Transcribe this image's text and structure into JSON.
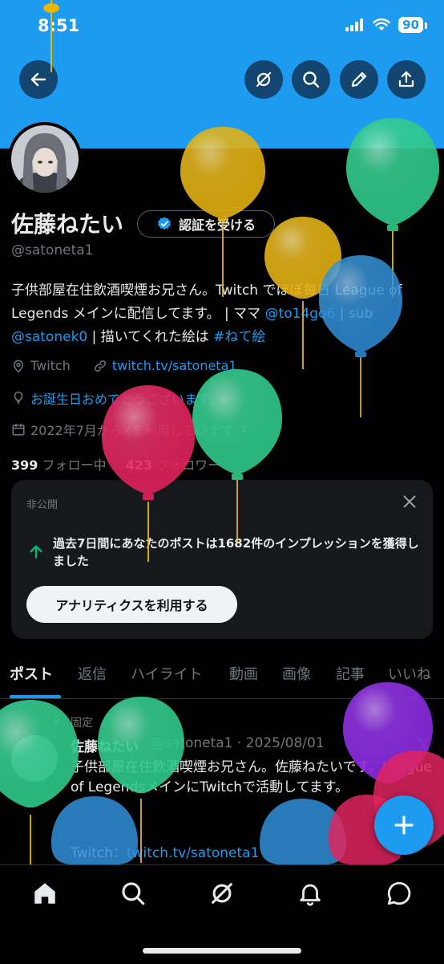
{
  "status": {
    "time": "8:51",
    "battery": "90"
  },
  "profile": {
    "name": "佐藤ねたい",
    "verify_label": "認証を受ける",
    "handle": "@satoneta1",
    "bio_text1": "子供部屋在住飲酒喫煙お兄さん。Twitch でほぼ毎日 League of Legends メインに配信してます。 | ママ ",
    "bio_mention1": "@to14go6",
    "bio_text2": " | sub ",
    "bio_mention2": "@satonek0",
    "bio_text3": " | 描いてくれた絵は ",
    "bio_hashtag": "#ねて絵",
    "location": "Twitch",
    "website": "twitch.tv/satoneta1",
    "birthday": "お誕生日おめでとうございます。",
    "joined": "2022年7月からXを利用しています",
    "following_count": "399",
    "following_label": " フォロー中",
    "followers_count": "423",
    "followers_label": " フォロワー"
  },
  "card": {
    "label": "非公開",
    "text": "過去7日間にあなたのポストは1682件のインプレッションを獲得しました",
    "button": "アナリティクスを利用する"
  },
  "tabs": [
    "ポスト",
    "返信",
    "ハイライト",
    "動画",
    "画像",
    "記事",
    "いいね"
  ],
  "post": {
    "pinned": "固定",
    "name": "佐藤ねたい",
    "handle_date": "@satoneta1 · 2025/08/01",
    "body": "子供部屋在住飲酒喫煙お兄さん。佐藤ねたいです。League of LegendsメインにTwitchで活動してます。",
    "link_label": "Twitch：",
    "link": "twitch.tv/satoneta1"
  },
  "colors": {
    "accent": "#1d9bf0",
    "banner": "#1d9bf0",
    "background": "#000000"
  }
}
